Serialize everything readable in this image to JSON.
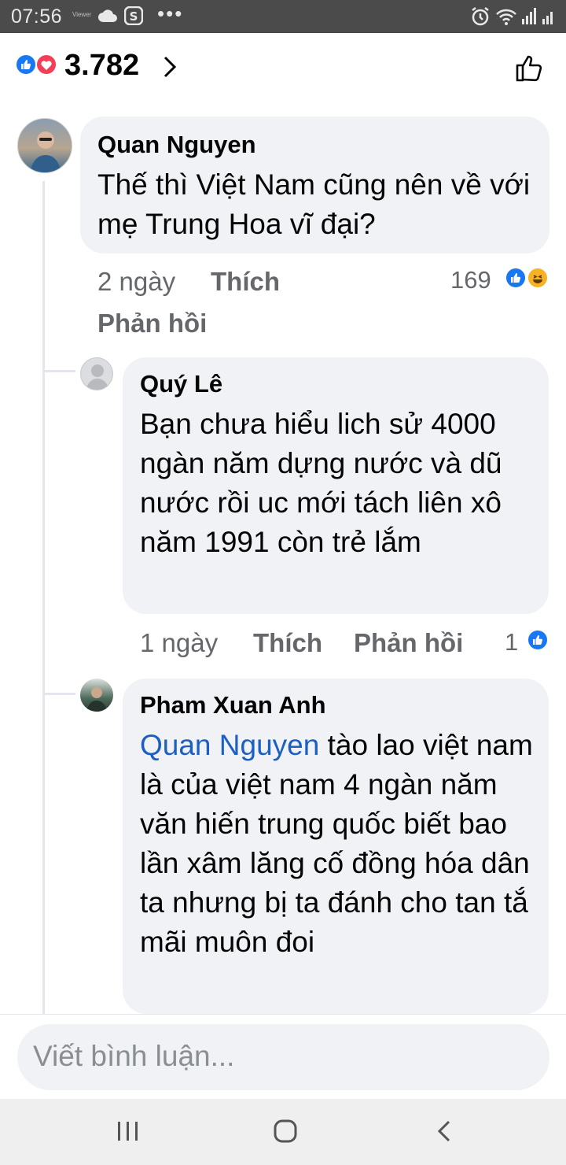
{
  "status_bar": {
    "time": "07:56",
    "small_label": "Viewer",
    "icons": [
      "cloud-icon",
      "skype-icon",
      "more-dots-icon",
      "alarm-icon",
      "wifi-icon",
      "signal-icon",
      "signal-icon-2"
    ]
  },
  "header": {
    "reaction_count": "3.782",
    "reaction_icons": [
      "like-reaction-icon",
      "love-reaction-icon"
    ],
    "like_button_icon": "thumbs-up-outline-icon"
  },
  "comments": [
    {
      "author": "Quan Nguyen",
      "text": "Thế thì Việt Nam cũng nên về với mẹ Trung Hoa vĩ đại?",
      "time": "2 ngày",
      "like_label": "Thích",
      "reply_label": "Phản hồi",
      "reaction_count": "169",
      "reactions": [
        "like",
        "haha"
      ]
    },
    {
      "author": "Quý Lê",
      "text": "Bạn chưa hiểu lich sử 4000 ngàn năm dựng nước và dũ nước rồi uc mới tách liên xô năm 1991 còn trẻ lắm",
      "time": "1 ngày",
      "like_label": "Thích",
      "reply_label": "Phản hồi",
      "reaction_count": "1",
      "reactions": [
        "like"
      ]
    },
    {
      "author": "Pham Xuan Anh",
      "mention": "Quan Nguyen",
      "text": "tào lao việt nam là của việt nam 4 ngàn năm văn hiến trung quốc biết bao lần xâm lăng cố đồng hóa dân ta nhưng bị ta đánh cho tan tắ mãi muôn đoi"
    }
  ],
  "composer": {
    "placeholder": "Viết bình luận..."
  },
  "nav": {
    "buttons": [
      "recent-apps-icon",
      "home-icon",
      "back-icon"
    ]
  }
}
